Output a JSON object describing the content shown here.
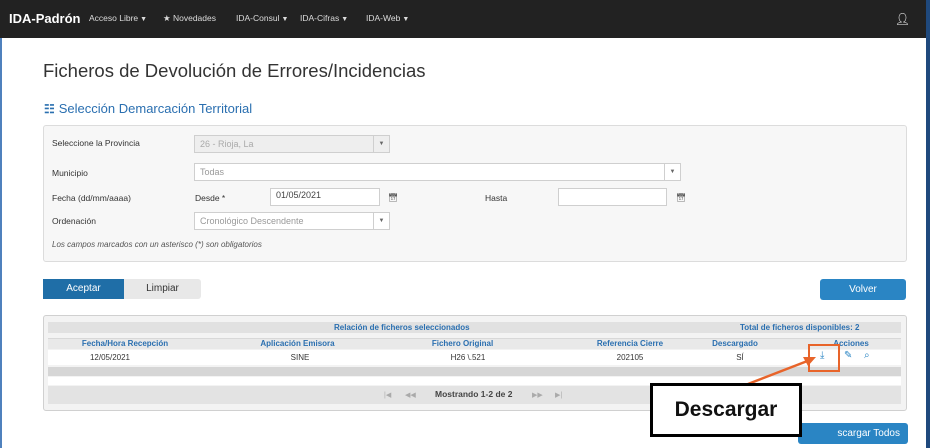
{
  "nav": {
    "brand": "IDA-Padrón",
    "items": [
      "Acceso Libre",
      "Novedades",
      "IDA-Consul",
      "IDA-Cifras",
      "IDA-Web"
    ]
  },
  "page": {
    "title": "Ficheros de Devolución de Errores/Incidencias",
    "section_title": "Selección Demarcación Territorial"
  },
  "form": {
    "province_label": "Seleccione la Provincia",
    "province_value": "26 - Rioja, La",
    "municipio_label": "Municipio",
    "municipio_value": "Todas",
    "fecha_label": "Fecha (dd/mm/aaaa)",
    "desde_label": "Desde *",
    "desde_value": "01/05/2021",
    "hasta_label": "Hasta",
    "hasta_value": "",
    "orden_label": "Ordenación",
    "orden_value": "Cronológico Descendente",
    "required_note": "Los campos marcados con un asterisco (*) son obligatorios"
  },
  "buttons": {
    "accept": "Aceptar",
    "clear": "Limpiar",
    "back": "Volver",
    "download_all": "scargar Todos"
  },
  "table": {
    "caption": "Relación de ficheros seleccionados",
    "total": "Total de ficheros disponibles: 2",
    "headers": [
      "Fecha/Hora Recepción",
      "Aplicación Emisora",
      "Fichero Original",
      "Referencia Cierre",
      "Descargado",
      "Acciones"
    ],
    "rows": [
      [
        "12/05/2021",
        "SINE",
        "H26 \\.521",
        "202105",
        "SÍ"
      ]
    ],
    "pager_text": "Mostrando 1-2 de 2"
  },
  "annotation": {
    "callout": "Descargar",
    "color": "#e8642a"
  }
}
